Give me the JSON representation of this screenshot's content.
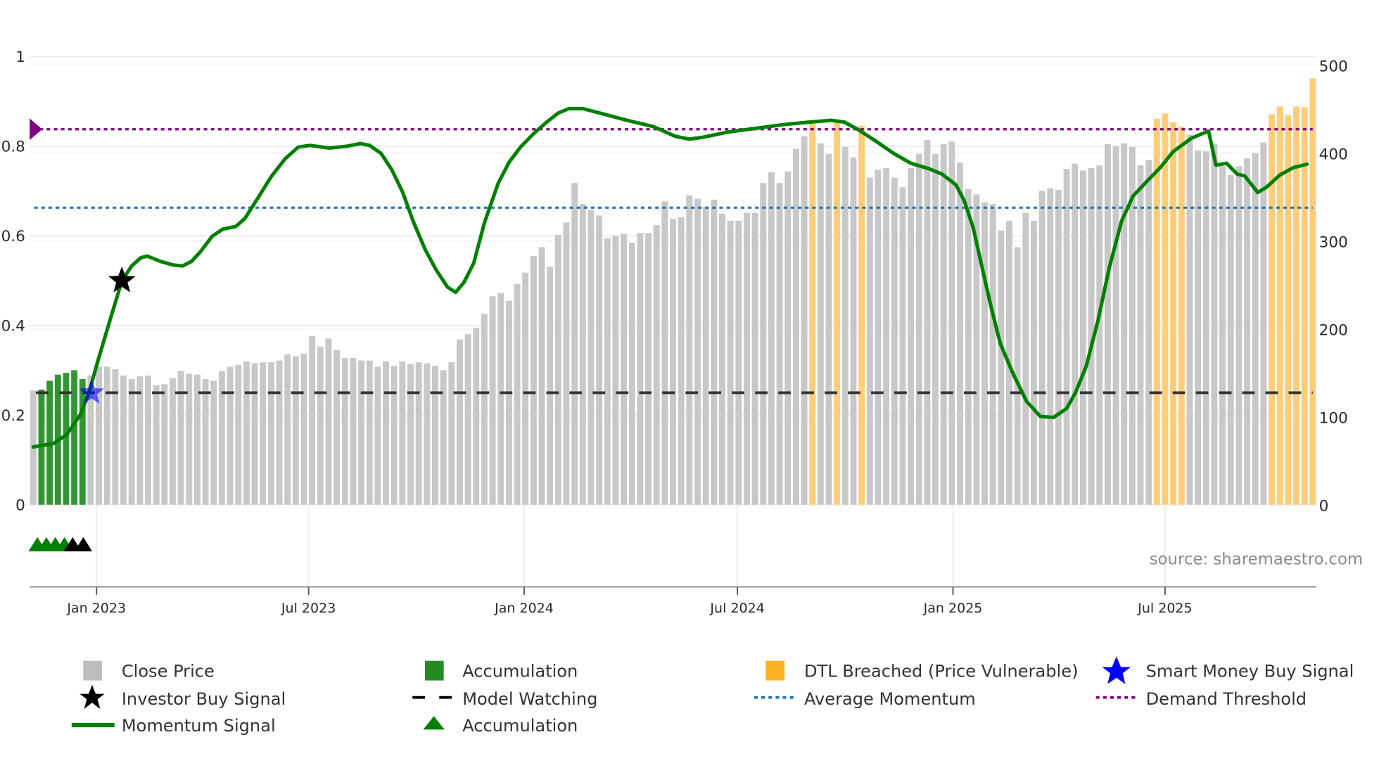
{
  "chart_data": {
    "type": "bar",
    "title": "",
    "source": "source: sharemaestro.com",
    "x_start": "2022-11-08",
    "x_frequency_days": 7,
    "x_ticks": [
      {
        "date": "2023-01-01",
        "label": "Jan 2023"
      },
      {
        "date": "2023-07-01",
        "label": "Jul 2023"
      },
      {
        "date": "2024-01-01",
        "label": "Jan 2024"
      },
      {
        "date": "2024-07-01",
        "label": "Jul 2024"
      },
      {
        "date": "2025-01-01",
        "label": "Jan 2025"
      },
      {
        "date": "2025-07-01",
        "label": "Jul 2025"
      }
    ],
    "left_axis": {
      "range": [
        -0.183,
        1.0
      ],
      "ticks": [
        {
          "v": 0,
          "label": "0"
        },
        {
          "v": 0.2,
          "label": "0.2"
        },
        {
          "v": 0.4,
          "label": "0.4"
        },
        {
          "v": 0.6,
          "label": "0.6"
        },
        {
          "v": 0.8,
          "label": "0.8"
        },
        {
          "v": 1,
          "label": "1"
        }
      ]
    },
    "right_axis": {
      "range": [
        0,
        510
      ],
      "ticks": [
        {
          "v": 0,
          "label": "0"
        },
        {
          "v": 100,
          "label": "100"
        },
        {
          "v": 200,
          "label": "200"
        },
        {
          "v": 300,
          "label": "300"
        },
        {
          "v": 400,
          "label": "400"
        },
        {
          "v": 500,
          "label": "500"
        }
      ]
    },
    "close_price": [
      130,
      131,
      141,
      148,
      150,
      153,
      143,
      147,
      157,
      157,
      154,
      147,
      143,
      146,
      147,
      136,
      137,
      144,
      152,
      149,
      148,
      143,
      141,
      152,
      157,
      159,
      163,
      161,
      162,
      162,
      164,
      171,
      169,
      172,
      192,
      180,
      189,
      176,
      167,
      167,
      164,
      164,
      157,
      163,
      158,
      163,
      160,
      162,
      161,
      158,
      153,
      162,
      188,
      194,
      201,
      217,
      237,
      241,
      232,
      251,
      264,
      283,
      293,
      271,
      307,
      321,
      366,
      342,
      335,
      329,
      303,
      306,
      308,
      298,
      309,
      309,
      318,
      345,
      325,
      327,
      352,
      348,
      339,
      347,
      331,
      323,
      323,
      332,
      332,
      366,
      378,
      366,
      379,
      405,
      419,
      435,
      411,
      399,
      435,
      407,
      395,
      431,
      372,
      381,
      383,
      372,
      361,
      383,
      399,
      415,
      399,
      410,
      413,
      389,
      359,
      353,
      344,
      342,
      312,
      323,
      293,
      332,
      323,
      357,
      360,
      358,
      382,
      388,
      380,
      383,
      386,
      410,
      408,
      411,
      407,
      386,
      392,
      439,
      445,
      435,
      430,
      421,
      403,
      402,
      410,
      385,
      375,
      385,
      394,
      400,
      412,
      444,
      453,
      443,
      453,
      452,
      485
    ],
    "bar_state": {
      "accumulation_weeks": [
        1,
        2,
        3,
        4,
        5,
        6
      ],
      "dtl_breached_weeks": [
        95,
        98,
        101,
        137,
        138,
        139,
        140,
        151,
        152,
        153,
        154,
        155,
        156
      ]
    },
    "momentum": {
      "week": [
        0,
        2.5,
        4.1,
        5.7,
        6.8,
        7.7,
        9.0,
        10.8,
        12.0,
        13.1,
        13.9,
        15.5,
        17.1,
        18.2,
        19.3,
        20.4,
        21.8,
        23.1,
        24.7,
        25.8,
        27.4,
        29.0,
        30.7,
        32.3,
        33.7,
        36.1,
        38.2,
        39.9,
        41.0,
        42.4,
        43.7,
        45.0,
        46.4,
        47.8,
        49.1,
        50.5,
        51.5,
        52.5,
        53.7,
        55.0,
        56.7,
        58.0,
        59.4,
        61.0,
        62.6,
        64.0,
        65.3,
        67.0,
        69.1,
        72.4,
        75.6,
        78.3,
        80.0,
        81.6,
        84.8,
        88.1,
        91.3,
        94.6,
        97.3,
        98.9,
        100.5,
        102.7,
        104.9,
        107.0,
        109.2,
        110.8,
        112.5,
        113.5,
        114.6,
        115.7,
        116.8,
        117.9,
        119.5,
        121.1,
        122.8,
        124.4,
        126.0,
        127.1,
        128.4,
        129.8,
        131.2,
        132.7,
        134.1,
        135.8,
        137.4,
        139.0,
        141.2,
        143.3,
        144.2,
        145.5,
        146.8,
        147.7,
        149.3,
        150.4,
        152.0,
        153.6,
        155.3
      ],
      "value": [
        0.129,
        0.137,
        0.157,
        0.2,
        0.25,
        0.31,
        0.39,
        0.5,
        0.533,
        0.551,
        0.555,
        0.543,
        0.535,
        0.533,
        0.543,
        0.565,
        0.599,
        0.615,
        0.621,
        0.639,
        0.685,
        0.732,
        0.772,
        0.798,
        0.802,
        0.796,
        0.8,
        0.806,
        0.802,
        0.784,
        0.748,
        0.699,
        0.629,
        0.569,
        0.525,
        0.486,
        0.474,
        0.496,
        0.539,
        0.629,
        0.718,
        0.764,
        0.798,
        0.828,
        0.854,
        0.874,
        0.884,
        0.884,
        0.874,
        0.858,
        0.844,
        0.822,
        0.816,
        0.82,
        0.832,
        0.84,
        0.848,
        0.854,
        0.858,
        0.854,
        0.838,
        0.812,
        0.784,
        0.762,
        0.75,
        0.738,
        0.714,
        0.679,
        0.619,
        0.529,
        0.44,
        0.36,
        0.291,
        0.231,
        0.197,
        0.195,
        0.215,
        0.251,
        0.31,
        0.41,
        0.529,
        0.633,
        0.689,
        0.722,
        0.752,
        0.788,
        0.818,
        0.834,
        0.758,
        0.762,
        0.738,
        0.734,
        0.697,
        0.709,
        0.736,
        0.752,
        0.76
      ]
    },
    "demand_threshold": 0.838,
    "average_momentum": 0.663,
    "model_watching": 0.25,
    "investor_buy_signals": [
      {
        "week": 10.8,
        "value": 0.5
      }
    ],
    "smart_money_buy_signals": [
      {
        "week": 7.1,
        "value": 0.25
      }
    ],
    "accumulation_triangles": {
      "green_weeks": [
        0.5,
        1.6,
        2.7,
        3.8
      ],
      "black_weeks": [
        4.8,
        6.1
      ],
      "value": -0.09
    },
    "colors": {
      "close": "#c8c8c8",
      "accumulation": "#228b22",
      "dtl": "#ffcc77",
      "momentum": "#008000",
      "demand": "#800080",
      "average": "#1f77b4",
      "watching": "#333333",
      "smart_money": "#0000ff",
      "investor": "#000000"
    },
    "legend": {
      "close_price": "Close Price",
      "investor_buy": "Investor Buy Signal",
      "momentum": "Momentum Signal",
      "accumulation_bar": "Accumulation",
      "model_watching": "Model Watching",
      "accumulation_marker": "Accumulation",
      "dtl_breached": "DTL Breached (Price Vulnerable)",
      "average_momentum": "Average Momentum",
      "smart_money": "Smart Money Buy Signal",
      "demand_threshold": "Demand Threshold"
    }
  }
}
